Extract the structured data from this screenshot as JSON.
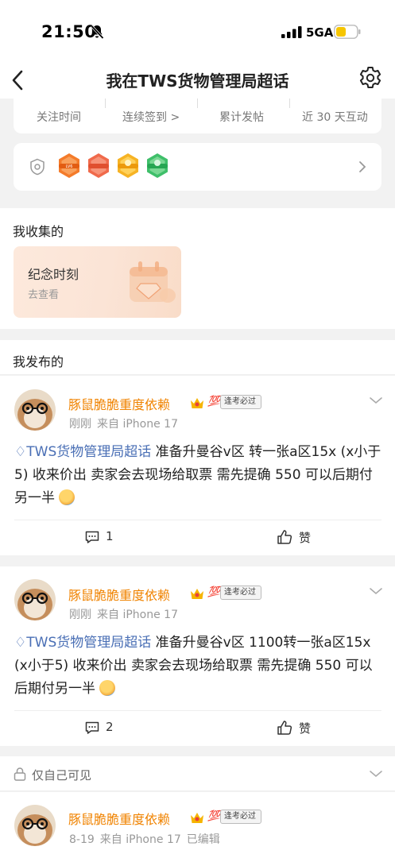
{
  "status_bar": {
    "time": "21:50",
    "network": "5GA"
  },
  "nav": {
    "title": "我在TWS货物管理局超话"
  },
  "stats": {
    "follow_time": "关注时间",
    "checkin": "连续签到 >",
    "posts": "累计发帖",
    "interaction": "近 30 天互动"
  },
  "badges": {
    "icons": [
      "badge-orange-lv",
      "badge-red",
      "badge-yellow",
      "badge-green"
    ]
  },
  "collection": {
    "title": "我收集的",
    "card_title": "纪念时刻",
    "card_sub": "去查看"
  },
  "published": {
    "title": "我发布的"
  },
  "posts": [
    {
      "username": "豚鼠脆脆重度依赖",
      "tag": "逢考必过",
      "time": "刚刚",
      "source": "来自 iPhone 17",
      "topic": "TWS货物管理局超话",
      "text": " 准备升曼谷v区 转一张a区15x (x小于5) 收来价出 卖家会去现场给取票 需先提确 550 可以后期付另一半 ",
      "comments": "1",
      "like_label": "赞"
    },
    {
      "username": "豚鼠脆脆重度依赖",
      "tag": "逢考必过",
      "time": "刚刚",
      "source": "来自 iPhone 17",
      "topic": "TWS货物管理局超话",
      "text": " 准备升曼谷v区 1100转一张a区15x (x小于5) 收来价出 卖家会去现场给取票 需先提确 550 可以后期付另一半 ",
      "comments": "2",
      "like_label": "赞"
    }
  ],
  "private_section": {
    "label": "仅自己可见"
  },
  "post3": {
    "username": "豚鼠脆脆重度依赖",
    "tag": "逢考必过",
    "date": "8-19",
    "source": "来自 iPhone 17",
    "edited": "已编辑"
  },
  "colors": {
    "username": "#f08300",
    "topic": "#4a6fb5",
    "background": "#f2f2f2"
  }
}
